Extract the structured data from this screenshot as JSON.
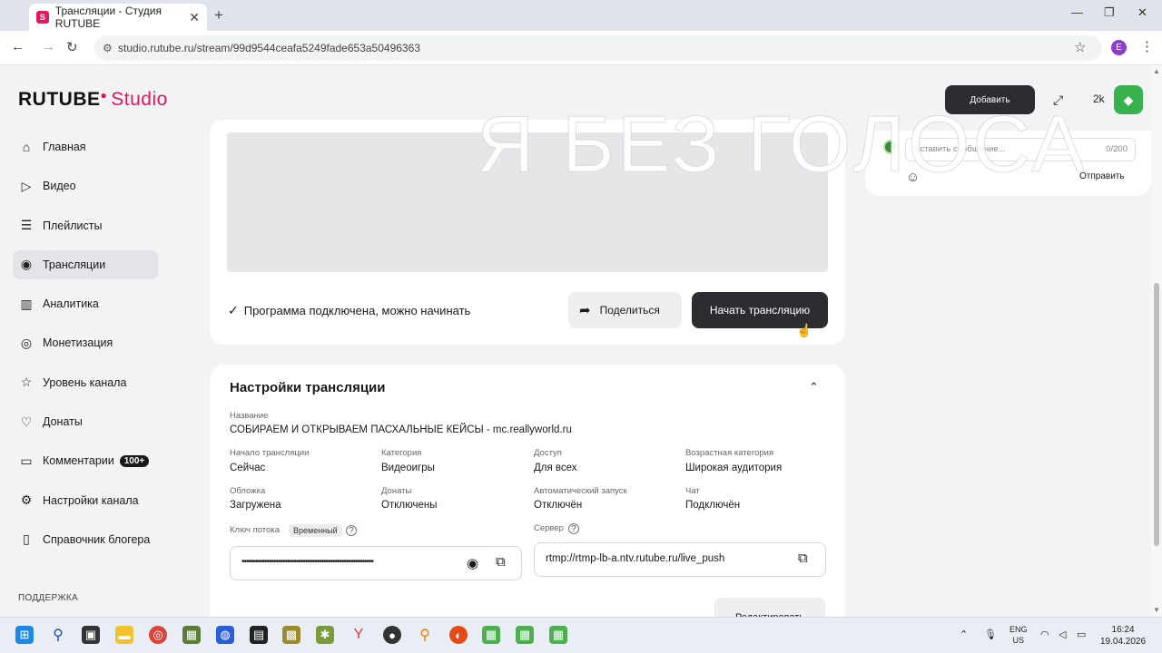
{
  "browser": {
    "tab_title": "Трансляции - Студия RUTUBE",
    "tab_favicon": "S",
    "close_tab": "✕",
    "new_tab": "+",
    "url": "studio.rutube.ru/stream/99d9544ceafa5249fade653a50496363",
    "profile_initial": "E"
  },
  "app": {
    "logo_text": "RUTUBE",
    "logo_studio": "Studio",
    "nav": [
      {
        "label": "Главная",
        "icon": "home-icon"
      },
      {
        "label": "Видео",
        "icon": "video-icon"
      },
      {
        "label": "Плейлисты",
        "icon": "playlist-icon"
      },
      {
        "label": "Трансляции",
        "icon": "broadcast-icon",
        "active": true
      },
      {
        "label": "Аналитика",
        "icon": "analytics-icon"
      },
      {
        "label": "Монетизация",
        "icon": "monetization-icon"
      },
      {
        "label": "Уровень канала",
        "icon": "star-icon"
      },
      {
        "label": "Донаты",
        "icon": "donate-icon"
      },
      {
        "label": "Комментарии",
        "icon": "comments-icon",
        "badge": "100+"
      },
      {
        "label": "Настройки канала",
        "icon": "gear-icon"
      },
      {
        "label": "Справочник блогера",
        "icon": "book-icon"
      }
    ],
    "support_label": "ПОДДЕРЖКА"
  },
  "stream": {
    "status_text": "Программа подключена, можно начинать",
    "share_label": "Поделиться",
    "start_label": "Начать трансляцию"
  },
  "settings": {
    "title": "Настройки трансляции",
    "name_label": "Название",
    "name_value": "СОБИРАЕМ И ОТКРЫВАЕМ ПАСХАЛЬНЫЕ КЕЙСЫ - mc.reallyworld.ru",
    "fields": [
      {
        "label": "Начало трансляции",
        "value": "Сейчас"
      },
      {
        "label": "Категория",
        "value": "Видеоигры"
      },
      {
        "label": "Доступ",
        "value": "Для всех"
      },
      {
        "label": "Возрастная категория",
        "value": "Широкая аудитория"
      },
      {
        "label": "Обложка",
        "value": "Загружена"
      },
      {
        "label": "Донаты",
        "value": "Отключены"
      },
      {
        "label": "Автоматический запуск",
        "value": "Отключён"
      },
      {
        "label": "Чат",
        "value": "Подключён"
      }
    ],
    "key_label": "Ключ потока",
    "key_tag": "Временный",
    "key_value": "••••••••••••••••••••••••••••••••••••••••••••••••••••••••••",
    "server_label": "Сервер",
    "server_value": "rtmp://rtmp-lb-a.ntv.rutube.ru/live_push",
    "edit_label": "Редактировать"
  },
  "chat": {
    "placeholder": "Оставить сообщение...",
    "counter": "0/200",
    "send_label": "Отправить"
  },
  "top_controls": {
    "add_label": "Добавить",
    "viewers": "2k"
  },
  "overlay_text": "Я БЕЗ ГОЛОСА",
  "taskbar": {
    "lang": "ENG",
    "region": "US",
    "time": "16:24",
    "date": "19.04.2026"
  },
  "colors": {
    "brand_pink": "#e0175b",
    "dark_button": "#2c2c33",
    "active_nav": "#e3e4e7"
  }
}
